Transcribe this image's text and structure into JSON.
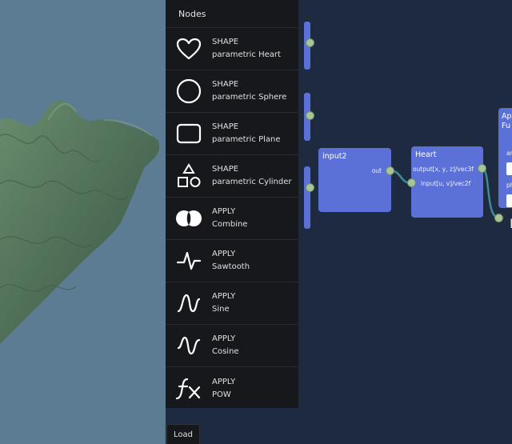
{
  "library": {
    "title": "Nodes",
    "items": [
      {
        "category": "SHAPE",
        "name": "parametric Heart",
        "icon": "heart-icon"
      },
      {
        "category": "SHAPE",
        "name": "parametric Sphere",
        "icon": "circle-icon"
      },
      {
        "category": "SHAPE",
        "name": "parametric Plane",
        "icon": "rounded-rect-icon"
      },
      {
        "category": "SHAPE",
        "name": "parametric Cylinder",
        "icon": "shapes-icon"
      },
      {
        "category": "APPLY",
        "name": "Combine",
        "icon": "venn-icon"
      },
      {
        "category": "APPLY",
        "name": "Sawtooth",
        "icon": "sawtooth-wave-icon"
      },
      {
        "category": "APPLY",
        "name": "Sine",
        "icon": "sine-wave-icon"
      },
      {
        "category": "APPLY",
        "name": "Cosine",
        "icon": "cosine-wave-icon"
      },
      {
        "category": "APPLY",
        "name": "POW",
        "icon": "function-icon"
      }
    ]
  },
  "graph": {
    "input2": {
      "title": "input2",
      "output": "out"
    },
    "heart": {
      "title": "Heart",
      "output": "output[x, y, z]/vec3f",
      "input": "input[u, v]/vec2f"
    },
    "partial": {
      "title_line1": "Ap",
      "title_line2": "Fu",
      "label_a": "an",
      "label_b": "ph",
      "label_c": "P"
    }
  },
  "toolbar": {
    "load_label": "Load"
  },
  "colors": {
    "editor_bg": "#1d2a3f",
    "node": "#5b71d8",
    "port": "#a8c597",
    "wire": "#3f8a97",
    "library_bg": "#17181b",
    "viewport_bg": "#5c7c94",
    "surface": "#4f6f58"
  }
}
